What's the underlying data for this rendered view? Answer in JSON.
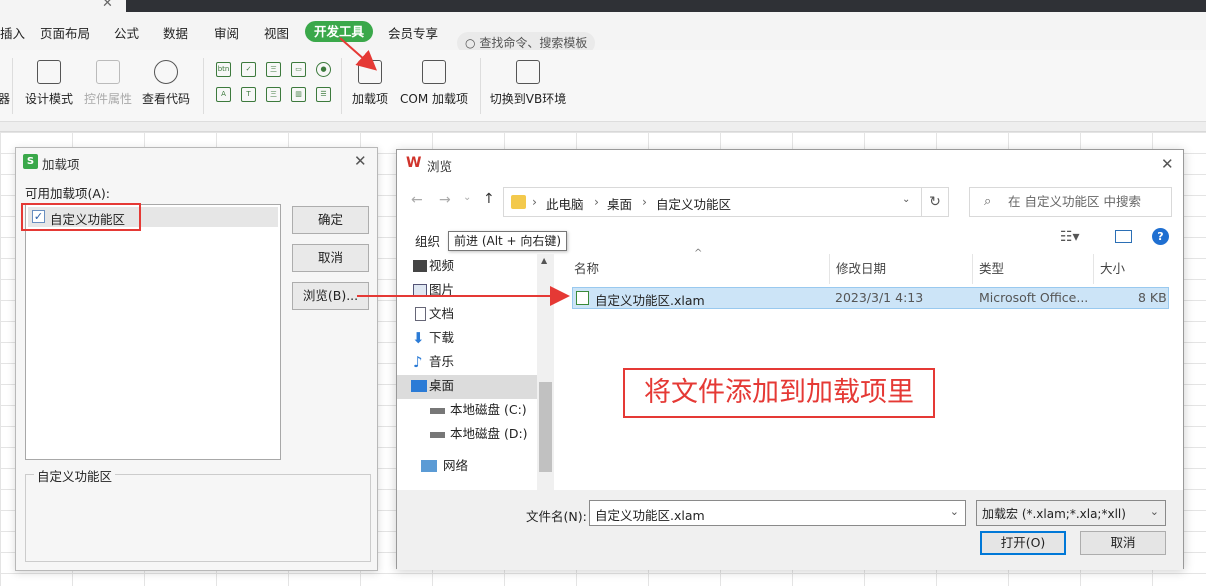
{
  "menubar": {
    "items": [
      "插入",
      "页面布局",
      "公式",
      "数据",
      "审阅",
      "视图",
      "开发工具",
      "会员专享"
    ],
    "active": "开发工具",
    "search_placeholder": "查找命令、搜索模板"
  },
  "ribbon": {
    "partial_left": "器",
    "design_mode": "设计模式",
    "control_props": "控件属性",
    "view_code": "查看代码",
    "addins": "加载项",
    "com_addins": "COM 加载项",
    "switch_vb": "切换到VB环境",
    "small_icons": [
      "btn",
      "✓",
      "三",
      "▭",
      "●",
      "A",
      "T",
      "三",
      "▥",
      "☰"
    ]
  },
  "addins_dialog": {
    "title": "加载项",
    "available_label": "可用加载项(A):",
    "items": [
      {
        "label": "自定义功能区",
        "checked": true
      }
    ],
    "ok": "确定",
    "cancel": "取消",
    "browse": "浏览(B)...",
    "group_title": "自定义功能区"
  },
  "browse_dialog": {
    "title": "浏览",
    "breadcrumb": [
      "此电脑",
      "桌面",
      "自定义功能区"
    ],
    "search_placeholder": "在 自定义功能区 中搜索",
    "organize": "组织",
    "tooltip": "前进 (Alt + 向右键)",
    "tree": [
      "视频",
      "图片",
      "文档",
      "下载",
      "音乐",
      "桌面",
      "本地磁盘 (C:)",
      "本地磁盘 (D:)",
      "网络"
    ],
    "selected_tree": "桌面",
    "columns": {
      "name": "名称",
      "modified": "修改日期",
      "type": "类型",
      "size": "大小"
    },
    "files": [
      {
        "name": "自定义功能区.xlam",
        "modified": "2023/3/1 4:13",
        "type": "Microsoft Office...",
        "size": "8 KB"
      }
    ],
    "filename_label": "文件名(N):",
    "filename_value": "自定义功能区.xlam",
    "filetype": "加载宏 (*.xlam;*.xla;*xll)",
    "open": "打开(O)",
    "cancel": "取消"
  },
  "annotation": "将文件添加到加载项里",
  "colors": {
    "accent_green": "#3aa84a",
    "annot_red": "#e53935",
    "selection_blue": "#cce4f7"
  }
}
